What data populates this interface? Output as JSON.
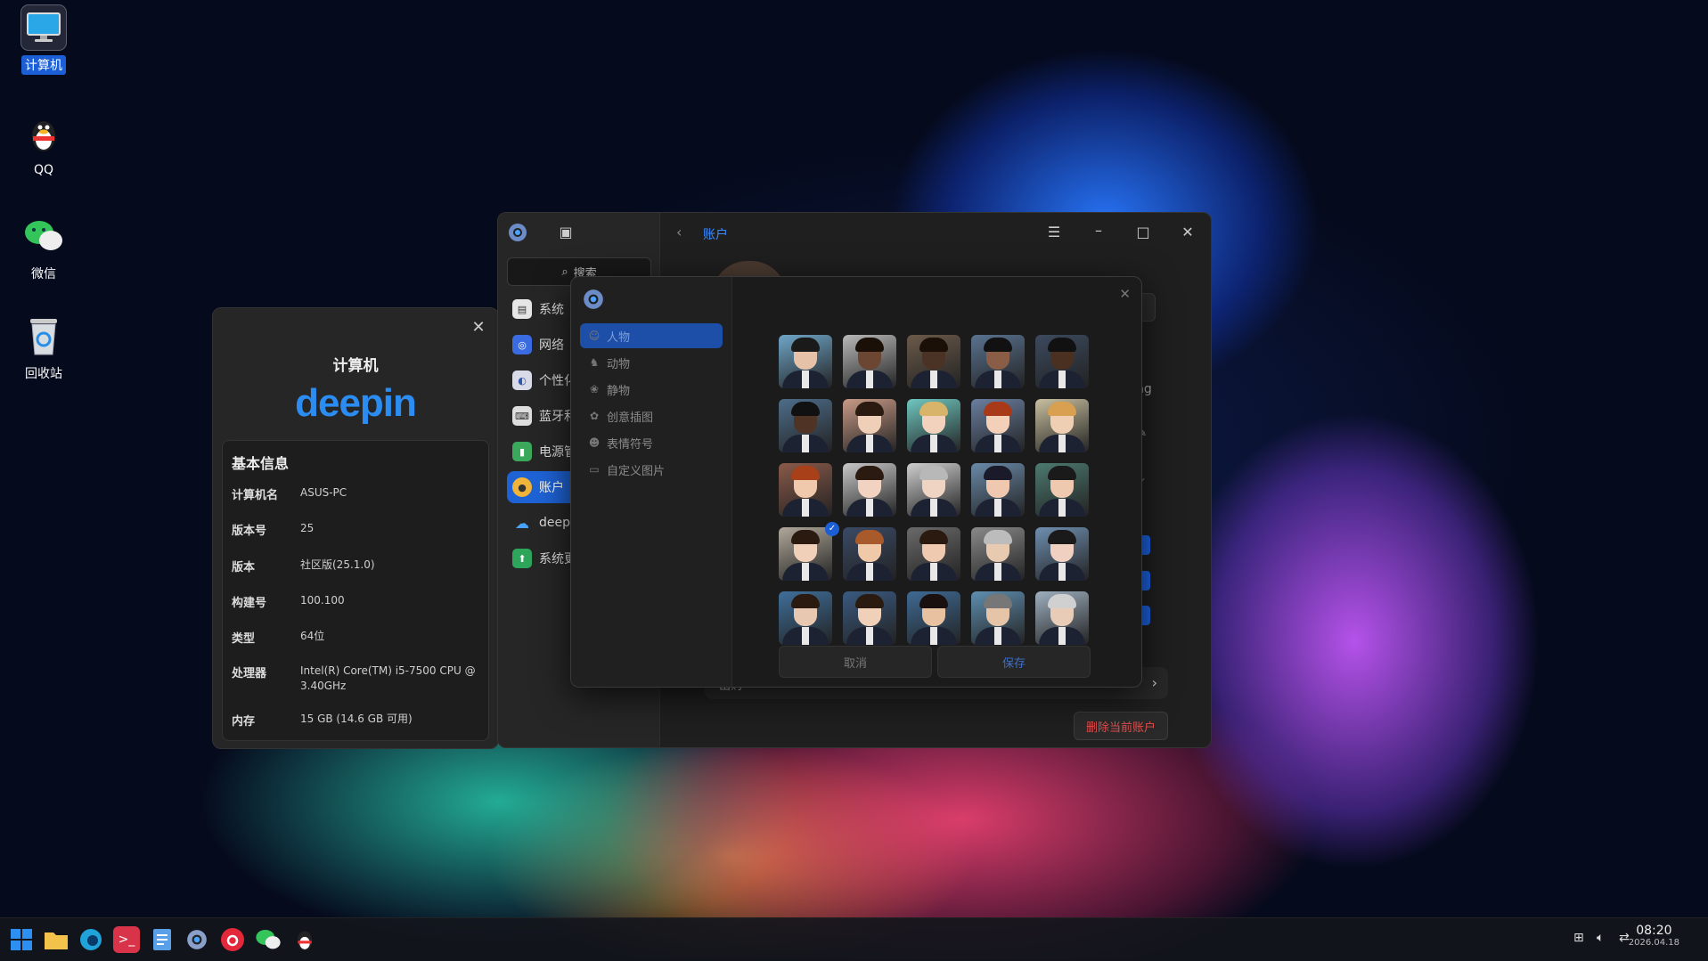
{
  "desktop": {
    "icons": [
      {
        "label": "计算机"
      },
      {
        "label": "QQ"
      },
      {
        "label": "微信"
      },
      {
        "label": "回收站"
      }
    ]
  },
  "about": {
    "title": "计算机",
    "logo": "deepin",
    "section_title": "基本信息",
    "rows": [
      {
        "key": "计算机名",
        "value": "ASUS-PC"
      },
      {
        "key": "版本号",
        "value": "25"
      },
      {
        "key": "版本",
        "value": "社区版(25.1.0)"
      },
      {
        "key": "构建号",
        "value": "100.100"
      },
      {
        "key": "类型",
        "value": "64位"
      },
      {
        "key": "处理器",
        "value": "Intel(R) Core(TM) i5-7500 CPU @ 3.40GHz"
      },
      {
        "key": "内存",
        "value": "15 GB (14.6 GB 可用)"
      }
    ]
  },
  "settings": {
    "breadcrumb": "账户",
    "search_placeholder": "搜索",
    "sidebar": [
      {
        "label": "系统",
        "icon": "system-icon"
      },
      {
        "label": "网络",
        "icon": "network-icon"
      },
      {
        "label": "个性化",
        "icon": "personalization-icon"
      },
      {
        "label": "蓝牙和",
        "icon": "bluetooth-icon"
      },
      {
        "label": "电源管",
        "icon": "power-icon"
      },
      {
        "label": "账户",
        "icon": "account-icon"
      },
      {
        "label": "deepi",
        "icon": "cloud-icon"
      },
      {
        "label": "系统更",
        "icon": "update-icon"
      }
    ],
    "partial_text_ng": "ng",
    "partial_row_label": "出购",
    "delete_account": "删除当前账户"
  },
  "avatar_dialog": {
    "categories": [
      {
        "label": "人物",
        "icon": "person-icon"
      },
      {
        "label": "动物",
        "icon": "animal-icon"
      },
      {
        "label": "静物",
        "icon": "still-life-icon"
      },
      {
        "label": "创意插图",
        "icon": "illustration-icon"
      },
      {
        "label": "表情符号",
        "icon": "emoji-icon"
      },
      {
        "label": "自定义图片",
        "icon": "folder-icon"
      }
    ],
    "cancel_label": "取消",
    "confirm_label": "保存",
    "selected_index": 15
  },
  "taskbar": {
    "time": "08:20",
    "date": "2026.04.18"
  }
}
